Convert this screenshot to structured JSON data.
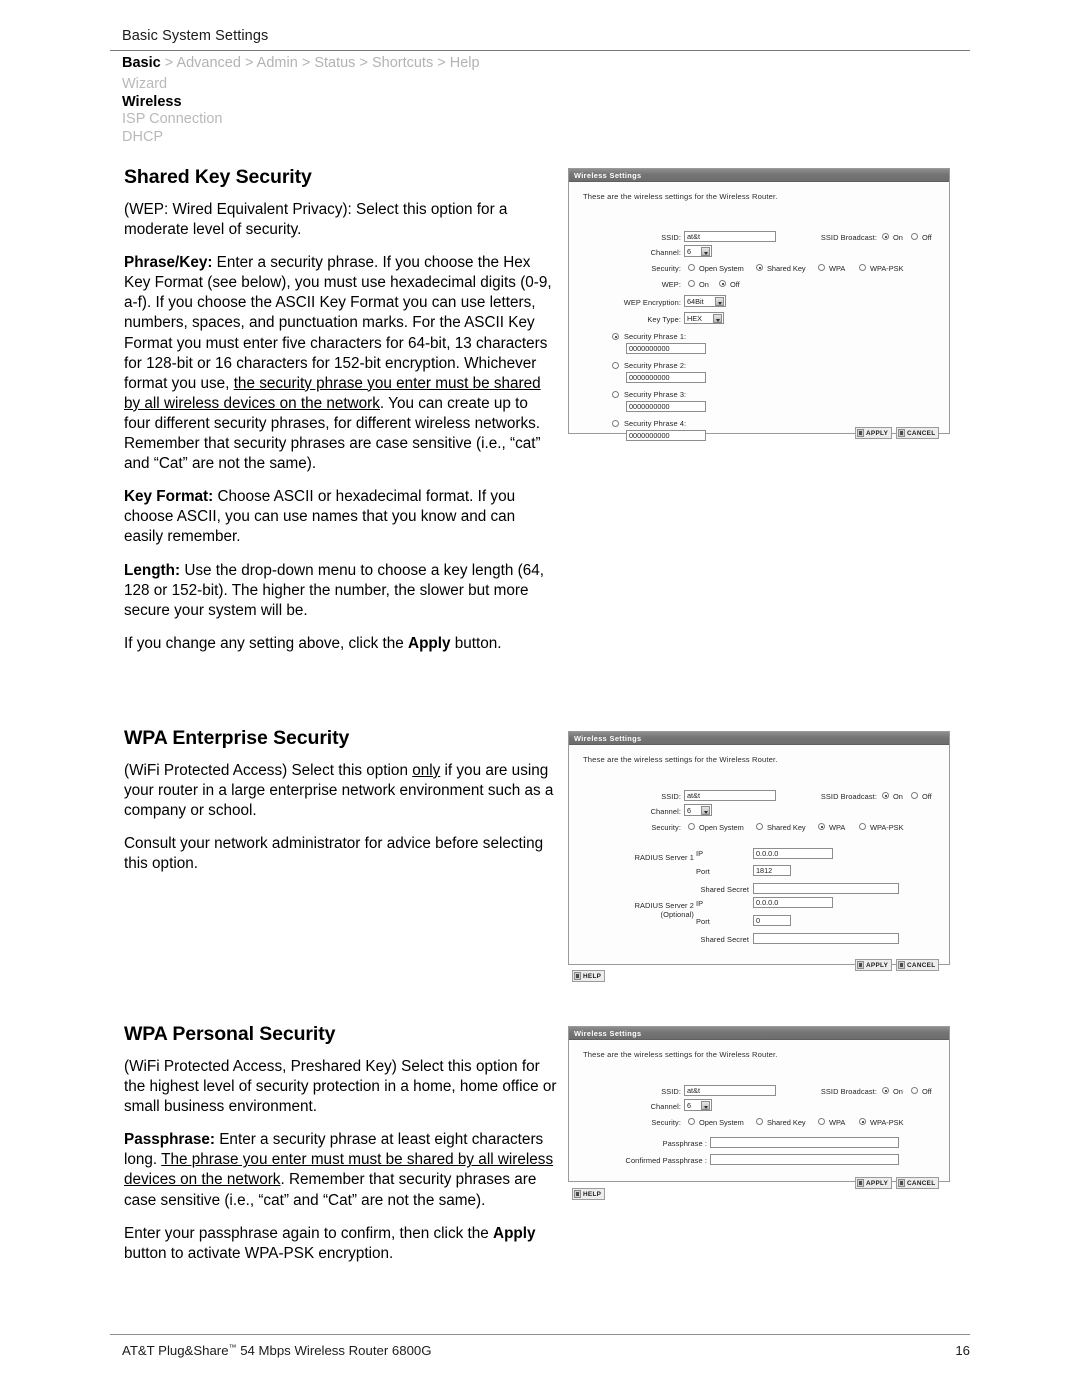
{
  "header": {
    "title": "Basic System Settings",
    "breadcrumb": {
      "active": "Basic",
      "separator": ">",
      "items": [
        "Advanced",
        "Admin",
        "Status",
        "Shortcuts",
        "Help"
      ]
    },
    "subnav": [
      {
        "label": "Wizard",
        "active": false
      },
      {
        "label": "Wireless",
        "active": true
      },
      {
        "label": "ISP Connection",
        "active": false
      },
      {
        "label": "DHCP",
        "active": false
      }
    ]
  },
  "sections": {
    "shared_key": {
      "heading": "Shared Key Security",
      "p1": "(WEP: Wired Equivalent Privacy): Select this option for a moderate level of security.",
      "p2_lead": "Phrase/Key:",
      "p2_a": " Enter a security phrase. If you choose the Hex Key Format (see below), you must use hexadecimal digits (0-9, a-f). If you choose the ASCII Key Format you can use letters, numbers, spaces, and punctuation marks. For the ASCII Key Format you must enter five characters for 64-bit, 13 characters for 128-bit or 16 characters for 152-bit encryption. Whichever format you use, ",
      "p2_u": "the security phrase you enter must be shared by all wireless devices on the network",
      "p2_b": ". You can create up to four different security phrases, for different wireless networks. Remember that security phrases are case sensitive (i.e., “cat” and “Cat” are not the same).",
      "p3_lead": "Key Format:",
      "p3": " Choose ASCII or hexadecimal format. If you choose ASCII, you can use names that you know and can easily remember.",
      "p4_lead": "Length:",
      "p4": " Use the drop-down menu to choose a key length (64, 128 or 152-bit). The higher the number, the slower but more secure your system will be.",
      "p5_a": "If you change any setting above, click the ",
      "p5_b": "Apply",
      "p5_c": " button."
    },
    "wpa_enterprise": {
      "heading": "WPA Enterprise Security",
      "p1_a": "(WiFi Protected Access) Select this option ",
      "p1_u": "only",
      "p1_b": " if you are using your router in a large enterprise network environment such as a company or school.",
      "p2": "Consult your network administrator for advice before selecting this option."
    },
    "wpa_personal": {
      "heading": "WPA Personal Security",
      "p1": "(WiFi Protected Access, Preshared Key) Select this option for the highest level of security protection in a home, home office or small business environment.",
      "p2_lead": "Passphrase:",
      "p2_a": " Enter a security phrase at least eight characters long. ",
      "p2_u": "The phrase you enter must must be shared by all wireless devices on the network",
      "p2_b": ". Remember that security phrases are case sensitive (i.e., “cat” and “Cat” are not the same).",
      "p3_a": "Enter your passphrase again to confirm, then click the ",
      "p3_b": "Apply",
      "p3_c": " button to activate WPA-PSK encryption."
    }
  },
  "panels": {
    "common": {
      "title": "Wireless Settings",
      "intro": "These are the wireless settings for the Wireless Router.",
      "ssid_label": "SSID:",
      "ssid_value": "at&t",
      "ssid_broadcast_label": "SSID Broadcast:",
      "on_label": "On",
      "off_label": "Off",
      "channel_label": "Channel:",
      "channel_value": "6",
      "security_label": "Security:",
      "security_options": [
        "Open System",
        "Shared Key",
        "WPA",
        "WPA-PSK"
      ],
      "apply_label": "APPLY",
      "cancel_label": "CANCEL",
      "help_label": "HELP"
    },
    "shared_key_panel": {
      "security_selected": "Shared Key",
      "ssid_broadcast_selected": "On",
      "wep_label": "WEP:",
      "wep_selected": "Off",
      "wep_encryption_label": "WEP Encryption:",
      "wep_encryption_value": "64Bit",
      "key_type_label": "Key Type:",
      "key_type_value": "HEX",
      "phrases": [
        {
          "label": "Security Phrase 1:",
          "value": "0000000000",
          "selected": true
        },
        {
          "label": "Security Phrase 2:",
          "value": "0000000000",
          "selected": false
        },
        {
          "label": "Security Phrase 3:",
          "value": "0000000000",
          "selected": false
        },
        {
          "label": "Security Phrase 4:",
          "value": "0000000000",
          "selected": false
        }
      ]
    },
    "wpa_panel": {
      "security_selected": "WPA",
      "radius1_label": "RADIUS Server 1",
      "radius2_label": "RADIUS Server 2",
      "radius2_sub": "(Optional)",
      "ip_label": "IP",
      "port_label": "Port",
      "shared_secret_label": "Shared Secret",
      "radius1_ip": "0.0.0.0",
      "radius1_port": "1812",
      "radius1_secret": "",
      "radius2_ip": "0.0.0.0",
      "radius2_port": "0",
      "radius2_secret": ""
    },
    "wpapsk_panel": {
      "security_selected": "WPA-PSK",
      "passphrase_label": "Passphrase :",
      "passphrase_value": "",
      "confirm_label": "Confirmed Passphrase :",
      "confirm_value": ""
    }
  },
  "footer": {
    "product": "AT&T Plug&Share",
    "tm": "™",
    "product_rest": " 54 Mbps Wireless Router 6800G",
    "page_number": "16"
  }
}
